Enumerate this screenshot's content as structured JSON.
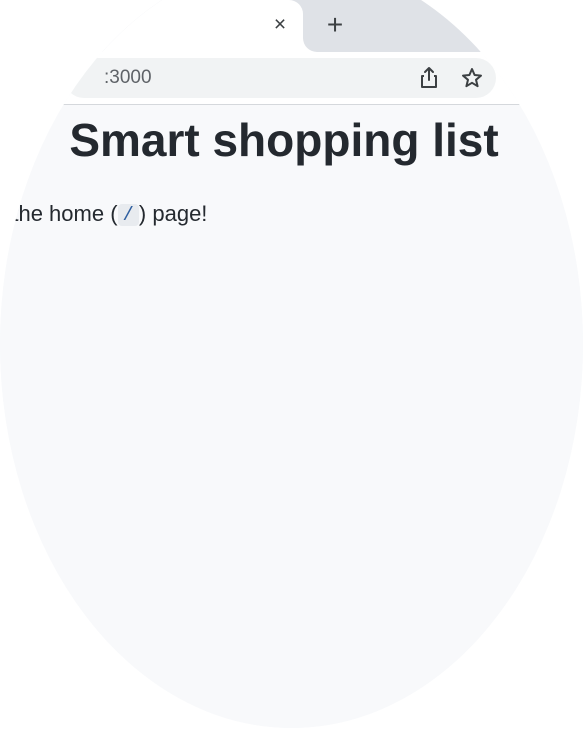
{
  "browser": {
    "tab_close": "×",
    "new_tab": "+",
    "url": ":3000"
  },
  "page": {
    "title": "Smart shopping list",
    "message_prefix": "n the home (",
    "message_code": "/",
    "message_suffix": ") page!"
  },
  "colors": {
    "page_bg": "#f8f9fb",
    "tabbar_bg": "#dfe2e7",
    "title_text": "#24292f",
    "code_text": "#2f5fa0"
  }
}
